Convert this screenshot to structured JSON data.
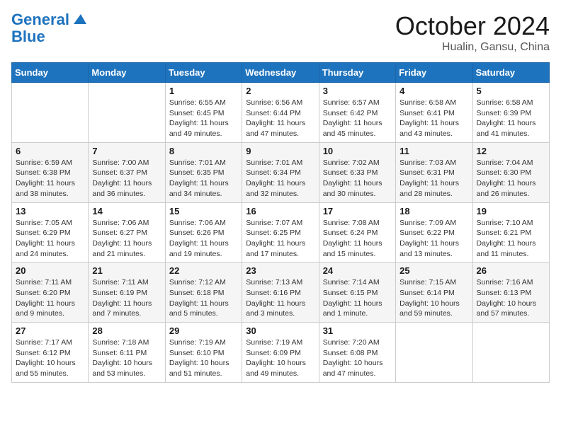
{
  "logo": {
    "line1": "General",
    "line2": "Blue"
  },
  "title": "October 2024",
  "subtitle": "Hualin, Gansu, China",
  "days_of_week": [
    "Sunday",
    "Monday",
    "Tuesday",
    "Wednesday",
    "Thursday",
    "Friday",
    "Saturday"
  ],
  "weeks": [
    [
      {
        "day": "",
        "info": ""
      },
      {
        "day": "",
        "info": ""
      },
      {
        "day": "1",
        "info": "Sunrise: 6:55 AM\nSunset: 6:45 PM\nDaylight: 11 hours and 49 minutes."
      },
      {
        "day": "2",
        "info": "Sunrise: 6:56 AM\nSunset: 6:44 PM\nDaylight: 11 hours and 47 minutes."
      },
      {
        "day": "3",
        "info": "Sunrise: 6:57 AM\nSunset: 6:42 PM\nDaylight: 11 hours and 45 minutes."
      },
      {
        "day": "4",
        "info": "Sunrise: 6:58 AM\nSunset: 6:41 PM\nDaylight: 11 hours and 43 minutes."
      },
      {
        "day": "5",
        "info": "Sunrise: 6:58 AM\nSunset: 6:39 PM\nDaylight: 11 hours and 41 minutes."
      }
    ],
    [
      {
        "day": "6",
        "info": "Sunrise: 6:59 AM\nSunset: 6:38 PM\nDaylight: 11 hours and 38 minutes."
      },
      {
        "day": "7",
        "info": "Sunrise: 7:00 AM\nSunset: 6:37 PM\nDaylight: 11 hours and 36 minutes."
      },
      {
        "day": "8",
        "info": "Sunrise: 7:01 AM\nSunset: 6:35 PM\nDaylight: 11 hours and 34 minutes."
      },
      {
        "day": "9",
        "info": "Sunrise: 7:01 AM\nSunset: 6:34 PM\nDaylight: 11 hours and 32 minutes."
      },
      {
        "day": "10",
        "info": "Sunrise: 7:02 AM\nSunset: 6:33 PM\nDaylight: 11 hours and 30 minutes."
      },
      {
        "day": "11",
        "info": "Sunrise: 7:03 AM\nSunset: 6:31 PM\nDaylight: 11 hours and 28 minutes."
      },
      {
        "day": "12",
        "info": "Sunrise: 7:04 AM\nSunset: 6:30 PM\nDaylight: 11 hours and 26 minutes."
      }
    ],
    [
      {
        "day": "13",
        "info": "Sunrise: 7:05 AM\nSunset: 6:29 PM\nDaylight: 11 hours and 24 minutes."
      },
      {
        "day": "14",
        "info": "Sunrise: 7:06 AM\nSunset: 6:27 PM\nDaylight: 11 hours and 21 minutes."
      },
      {
        "day": "15",
        "info": "Sunrise: 7:06 AM\nSunset: 6:26 PM\nDaylight: 11 hours and 19 minutes."
      },
      {
        "day": "16",
        "info": "Sunrise: 7:07 AM\nSunset: 6:25 PM\nDaylight: 11 hours and 17 minutes."
      },
      {
        "day": "17",
        "info": "Sunrise: 7:08 AM\nSunset: 6:24 PM\nDaylight: 11 hours and 15 minutes."
      },
      {
        "day": "18",
        "info": "Sunrise: 7:09 AM\nSunset: 6:22 PM\nDaylight: 11 hours and 13 minutes."
      },
      {
        "day": "19",
        "info": "Sunrise: 7:10 AM\nSunset: 6:21 PM\nDaylight: 11 hours and 11 minutes."
      }
    ],
    [
      {
        "day": "20",
        "info": "Sunrise: 7:11 AM\nSunset: 6:20 PM\nDaylight: 11 hours and 9 minutes."
      },
      {
        "day": "21",
        "info": "Sunrise: 7:11 AM\nSunset: 6:19 PM\nDaylight: 11 hours and 7 minutes."
      },
      {
        "day": "22",
        "info": "Sunrise: 7:12 AM\nSunset: 6:18 PM\nDaylight: 11 hours and 5 minutes."
      },
      {
        "day": "23",
        "info": "Sunrise: 7:13 AM\nSunset: 6:16 PM\nDaylight: 11 hours and 3 minutes."
      },
      {
        "day": "24",
        "info": "Sunrise: 7:14 AM\nSunset: 6:15 PM\nDaylight: 11 hours and 1 minute."
      },
      {
        "day": "25",
        "info": "Sunrise: 7:15 AM\nSunset: 6:14 PM\nDaylight: 10 hours and 59 minutes."
      },
      {
        "day": "26",
        "info": "Sunrise: 7:16 AM\nSunset: 6:13 PM\nDaylight: 10 hours and 57 minutes."
      }
    ],
    [
      {
        "day": "27",
        "info": "Sunrise: 7:17 AM\nSunset: 6:12 PM\nDaylight: 10 hours and 55 minutes."
      },
      {
        "day": "28",
        "info": "Sunrise: 7:18 AM\nSunset: 6:11 PM\nDaylight: 10 hours and 53 minutes."
      },
      {
        "day": "29",
        "info": "Sunrise: 7:19 AM\nSunset: 6:10 PM\nDaylight: 10 hours and 51 minutes."
      },
      {
        "day": "30",
        "info": "Sunrise: 7:19 AM\nSunset: 6:09 PM\nDaylight: 10 hours and 49 minutes."
      },
      {
        "day": "31",
        "info": "Sunrise: 7:20 AM\nSunset: 6:08 PM\nDaylight: 10 hours and 47 minutes."
      },
      {
        "day": "",
        "info": ""
      },
      {
        "day": "",
        "info": ""
      }
    ]
  ]
}
